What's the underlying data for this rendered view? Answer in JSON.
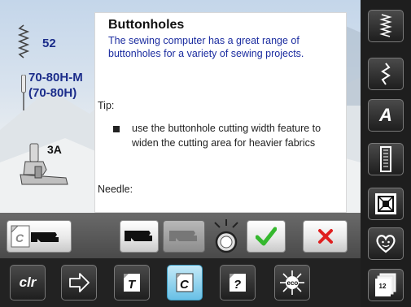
{
  "stitch": {
    "number": "52"
  },
  "needle": {
    "size": "70-80H-M",
    "alt_size": "(70-80H)"
  },
  "foot": {
    "number": "3A"
  },
  "help": {
    "title": "Buttonholes",
    "description": "The sewing computer has a great range of buttonholes for a variety of sewing projects.",
    "tip_label": "Tip:",
    "bullet": "use the buttonhole cutting width feature to widen the cutting area for heavier fabrics",
    "needle_label": "Needle:"
  },
  "bottom_bar": {
    "clear_label": "clr",
    "active_tab": "c-icon"
  },
  "right_bar": {
    "alpha_label": "A",
    "page_label": "12"
  },
  "colors": {
    "accent_blue": "#1b2c8a",
    "confirm_green": "#35b82e",
    "cancel_red": "#e02020",
    "active_tab": "#7fd0f0"
  }
}
